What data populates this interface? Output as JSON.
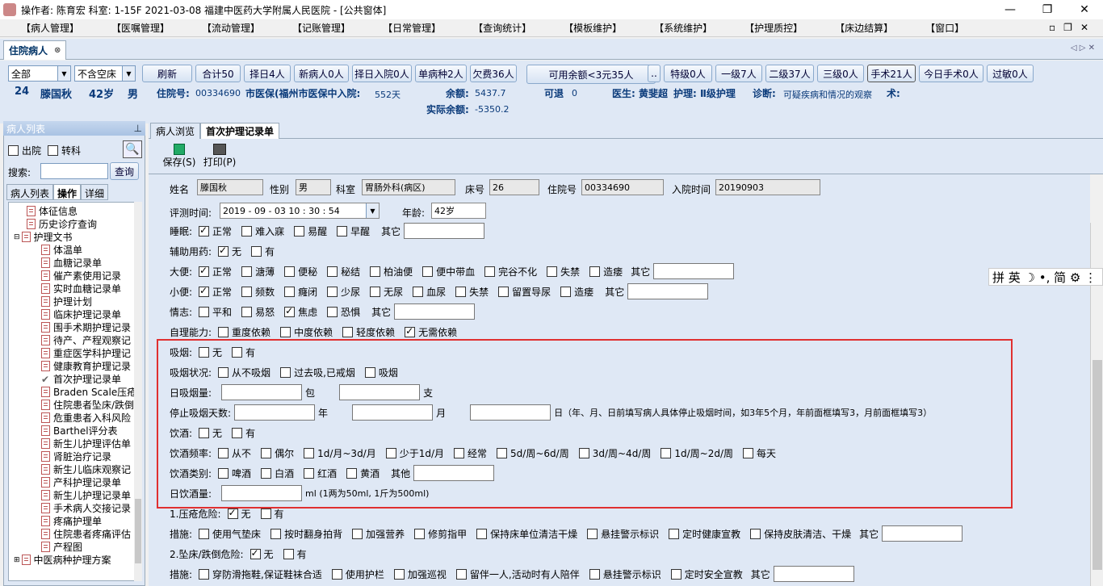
{
  "title": "操作者: 陈育宏  科室: 1-15F  2021-03-08  福建中医药大学附属人民医院 - [公共窗体]",
  "menu": [
    "【病人管理】",
    "【医嘱管理】",
    "【流动管理】",
    "【记账管理】",
    "【日常管理】",
    "【查询统计】",
    "【模板维护】",
    "【系统维护】",
    "【护理质控】",
    "【床边结算】",
    "【窗口】"
  ],
  "tab": "住院病人",
  "filters": {
    "ward": "全部",
    "bed": "不含空床"
  },
  "buttons": [
    "刷新",
    "合计50",
    "择日4人",
    "新病人0人",
    "择日入院0人",
    "单病种2人",
    "欠费36人",
    "可用余额<3元35人",
    "特级0人",
    "一级7人",
    "二级37人",
    "三级0人",
    "手术21人",
    "今日手术0人",
    "过敏0人"
  ],
  "patient": {
    "bed": "24",
    "name": "滕国秋",
    "age": "42岁",
    "sex": "男",
    "inpatient_label": "住院号:",
    "inpatient_no": "00334690",
    "insurance": "市医保(福州市医保中入院:",
    "days": "552天",
    "balance_label": "余额:",
    "balance": "5437.7",
    "refund_label": "可退",
    "refund": "0",
    "doctor": "医生: 黄斐超",
    "nurse": "护理: Ⅱ级护理",
    "diagnosis_label": "诊断:",
    "diagnosis": "可疑疾病和情况的观察",
    "op": "术:",
    "actual_label": "实际余额:",
    "actual": "-5350.2"
  },
  "left": {
    "title": "病人列表",
    "discharge": "出院",
    "transfer": "转科",
    "search_label": "搜索:",
    "search_btn": "查询",
    "tabs": [
      "病人列表",
      "操作",
      "详细"
    ],
    "tree": [
      "体征信息",
      "历史诊疗查询",
      "护理文书",
      "体温单",
      "血糖记录单",
      "催产素使用记录",
      "实时血糖记录单",
      "护理计划",
      "临床护理记录单",
      "围手术期护理记录",
      "待产、产程观察记",
      "重症医学科护理记",
      "健康教育护理记录",
      "首次护理记录单",
      "Braden Scale压疮",
      "住院患者坠床/跌倒",
      "危重患者入科风险",
      "Barthel评分表",
      "新生儿护理评估单",
      "肾脏治疗记录",
      "新生儿临床观察记",
      "产科护理记录单",
      "新生儿护理记录单",
      "手术病人交接记录",
      "疼痛护理单",
      "住院患者疼痛评估",
      "产程图",
      "中医病种护理方案"
    ]
  },
  "right": {
    "tabs": [
      "病人浏览",
      "首次护理记录单"
    ],
    "save": "保存(S)",
    "print": "打印(P)",
    "fields": {
      "name_l": "姓名",
      "name": "滕国秋",
      "sex_l": "性别",
      "sex": "男",
      "dept_l": "科室",
      "dept": "胃肠外科(病区)",
      "bed_l": "床号",
      "bed": "26",
      "no_l": "住院号",
      "no": "00334690",
      "adm_l": "入院时间",
      "adm": "20190903",
      "time_l": "评测时间:",
      "time": "2019 - 09 - 03    10 : 30 : 54",
      "age_l": "年龄:",
      "age": "42岁"
    }
  },
  "ime": "拼 英 ☽ •, 简 ⚙ ⋮"
}
